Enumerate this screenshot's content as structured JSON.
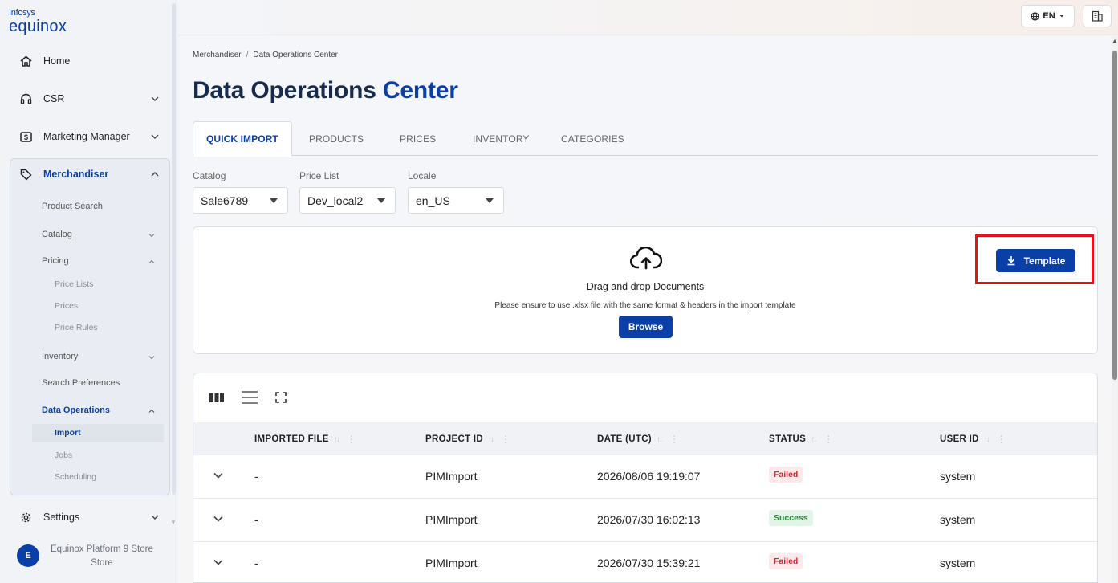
{
  "logo": {
    "line1": "Infosys",
    "line2": "equinox"
  },
  "sidebar": {
    "home": "Home",
    "csr": "CSR",
    "marketing_manager": "Marketing Manager",
    "merchandiser": "Merchandiser",
    "product_search": "Product Search",
    "catalog": "Catalog",
    "pricing": "Pricing",
    "price_lists": "Price Lists",
    "prices": "Prices",
    "price_rules": "Price Rules",
    "inventory": "Inventory",
    "search_preferences": "Search Preferences",
    "data_operations": "Data Operations",
    "import": "Import",
    "jobs": "Jobs",
    "scheduling": "Scheduling",
    "settings": "Settings"
  },
  "user": {
    "initial": "E",
    "name_line1": "Equinox Platform 9 Store",
    "name_line2": "Store"
  },
  "topbar": {
    "language": "EN"
  },
  "breadcrumb": {
    "parent": "Merchandiser",
    "separator": "/",
    "current": "Data Operations Center"
  },
  "page": {
    "title_part1": "Data Operations",
    "title_part2": "Center"
  },
  "tabs": [
    {
      "label": "QUICK IMPORT",
      "active": true
    },
    {
      "label": "PRODUCTS",
      "active": false
    },
    {
      "label": "PRICES",
      "active": false
    },
    {
      "label": "INVENTORY",
      "active": false
    },
    {
      "label": "CATEGORIES",
      "active": false
    }
  ],
  "filters": {
    "catalog": {
      "label": "Catalog",
      "value": "Sale6789"
    },
    "price_list": {
      "label": "Price List",
      "value": "Dev_local2"
    },
    "locale": {
      "label": "Locale",
      "value": "en_US"
    }
  },
  "upload": {
    "drag_text": "Drag and drop Documents",
    "ensure_text": "Please ensure to use .xlsx file with the same format & headers in the import template",
    "browse_label": "Browse",
    "template_label": "Template"
  },
  "table": {
    "columns": [
      "IMPORTED FILE",
      "PROJECT ID",
      "DATE (UTC)",
      "STATUS",
      "USER ID"
    ],
    "rows": [
      {
        "file": "-",
        "project": "PIMImport",
        "date": "2026/08/06 19:19:07",
        "status": "Failed",
        "user": "system"
      },
      {
        "file": "-",
        "project": "PIMImport",
        "date": "2026/07/30 16:02:13",
        "status": "Success",
        "user": "system"
      },
      {
        "file": "-",
        "project": "PIMImport",
        "date": "2026/07/30 15:39:21",
        "status": "Failed",
        "user": "system"
      }
    ]
  },
  "colors": {
    "primary": "#0a3fa8",
    "title_dark": "#172b4d",
    "highlight_frame": "#e0141a",
    "failed": "#d9232e",
    "success": "#1f8a3a"
  }
}
